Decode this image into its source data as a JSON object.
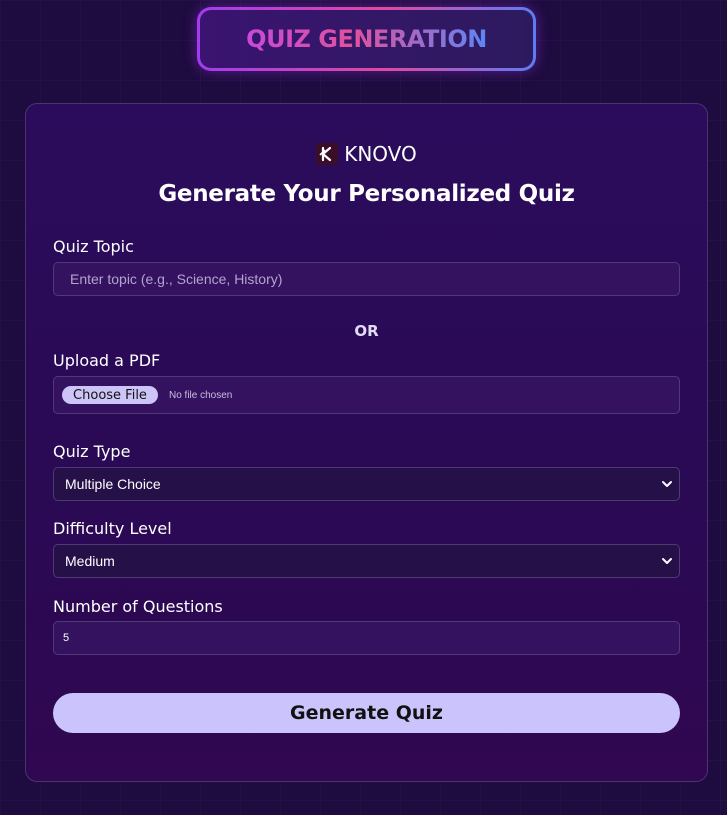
{
  "banner": {
    "title": "QUIZ GENERATION"
  },
  "brand": {
    "name": "KNOVO",
    "logo_icon": "knovo-logo-icon"
  },
  "form": {
    "heading": "Generate Your Personalized Quiz",
    "topic": {
      "label": "Quiz Topic",
      "placeholder": "Enter topic (e.g., Science, History)",
      "value": ""
    },
    "separator": "OR",
    "pdf": {
      "label": "Upload a PDF",
      "button_label": "Choose File",
      "status": "No file chosen"
    },
    "quiz_type": {
      "label": "Quiz Type",
      "selected": "Multiple Choice"
    },
    "difficulty": {
      "label": "Difficulty Level",
      "selected": "Medium"
    },
    "num_questions": {
      "label": "Number of Questions",
      "value": "5"
    },
    "submit_label": "Generate Quiz"
  },
  "colors": {
    "background": "#1e0b3f",
    "card": "#2b0c5c",
    "accent_button": "#cbc3fb",
    "banner_gradient": [
      "#c84ad8",
      "#e0529c",
      "#5c86f6"
    ]
  }
}
